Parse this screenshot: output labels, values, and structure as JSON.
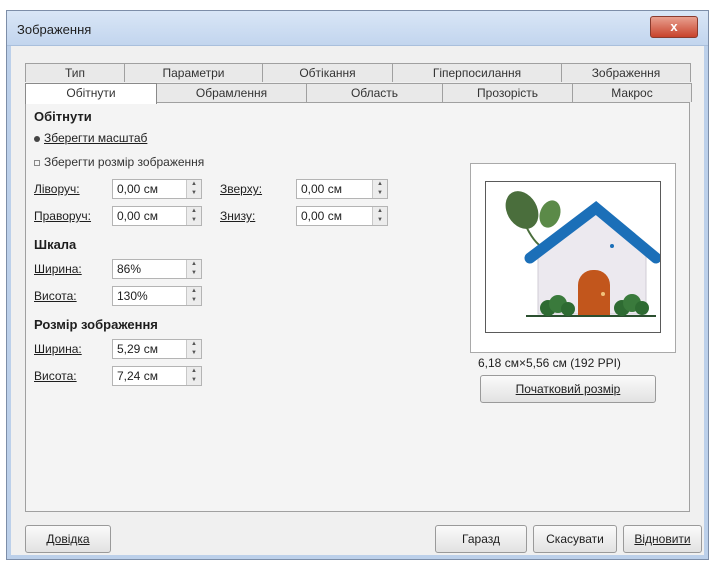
{
  "window": {
    "title": "Зображення",
    "close_glyph": "x"
  },
  "tabs": {
    "row1": [
      "Тип",
      "Параметри",
      "Обтікання",
      "Гіперпосилання",
      "Зображення"
    ],
    "row2": [
      "Обітнути",
      "Обрамлення",
      "Область",
      "Прозорість",
      "Макрос"
    ],
    "active": "Обітнути"
  },
  "crop": {
    "section_title": "Обітнути",
    "keep_scale_label": "Зберегти масштаб",
    "keep_size_label": "Зберегти розмір зображення",
    "left_label": "Ліворуч:",
    "left_value": "0,00 см",
    "top_label": "Зверху:",
    "top_value": "0,00 см",
    "right_label": "Праворуч:",
    "right_value": "0,00 см",
    "bottom_label": "Знизу:",
    "bottom_value": "0,00 см"
  },
  "scale": {
    "section_title": "Шкала",
    "width_label": "Ширина:",
    "width_value": "86%",
    "height_label": "Висота:",
    "height_value": "130%"
  },
  "image_size": {
    "section_title": "Розмір зображення",
    "width_label": "Ширина:",
    "width_value": "5,29 см",
    "height_label": "Висота:",
    "height_value": "7,24 см"
  },
  "original": {
    "info": "6,18 см×5,56 см (192 PPI)",
    "original_size_button": "Початковий розмір"
  },
  "buttons": {
    "help": "Довідка",
    "ok": "Гаразд",
    "cancel": "Скасувати",
    "reset": "Відновити"
  },
  "colors": {
    "roof": "#1b6fb8",
    "door": "#c2561c",
    "leaf": "#4a6e3c",
    "bush": "#2e6b32",
    "wall": "#ece9ef"
  }
}
